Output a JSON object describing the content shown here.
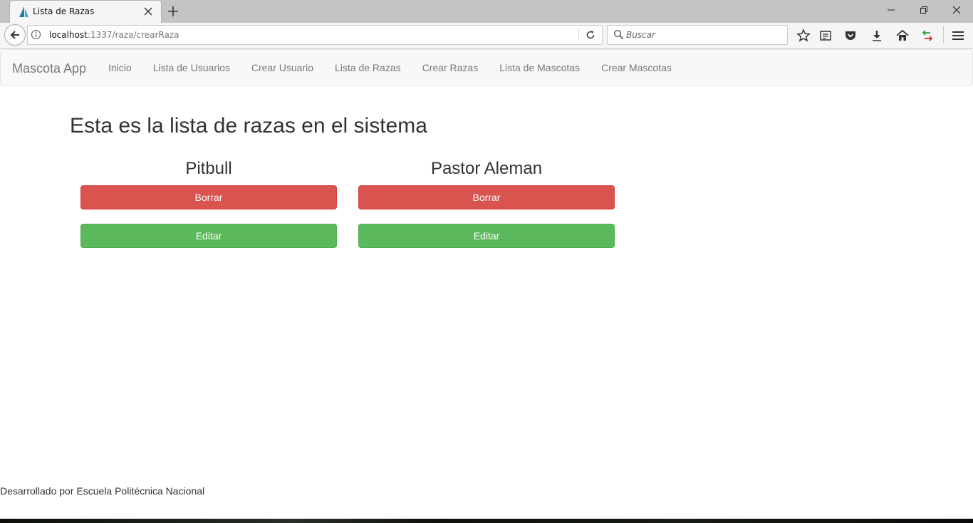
{
  "browser": {
    "tab_title": "Lista de Razas",
    "url_host": "localhost",
    "url_rest": ":1337/raza/crearRaza",
    "search_placeholder": "Buscar"
  },
  "navbar": {
    "brand": "Mascota App",
    "links": [
      "Inicio",
      "Lista de Usuarios",
      "Crear Usuario",
      "Lista de Razas",
      "Crear Razas",
      "Lista de Mascotas",
      "Crear Mascotas"
    ]
  },
  "main": {
    "title": "Esta es la lista de razas en el sistema",
    "breeds": [
      {
        "name": "Pitbull",
        "delete_label": "Borrar",
        "edit_label": "Editar"
      },
      {
        "name": "Pastor Aleman",
        "delete_label": "Borrar",
        "edit_label": "Editar"
      }
    ]
  },
  "footer": {
    "text": "Desarrollado por Escuela Politécnica Nacional"
  },
  "colors": {
    "danger": "#d9534f",
    "success": "#5cb85c",
    "navbar_bg": "#f8f8f8"
  }
}
